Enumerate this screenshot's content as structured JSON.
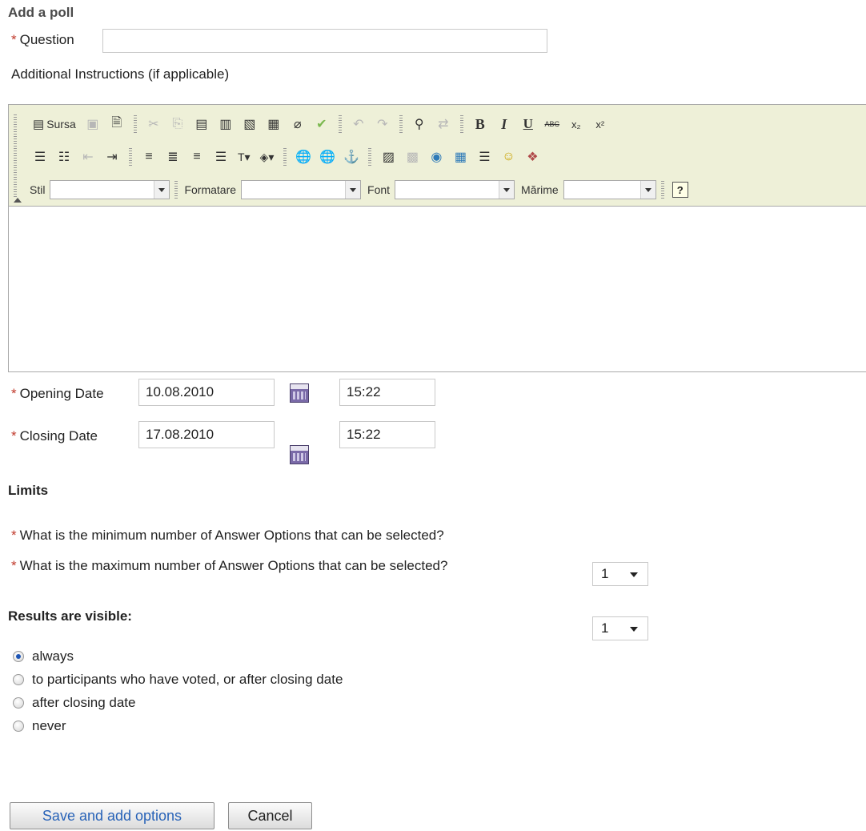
{
  "page": {
    "title": "Add a poll"
  },
  "form": {
    "required_marker": "*",
    "question_label": "Question",
    "question_value": "",
    "instructions_label": "Additional Instructions (if applicable)",
    "opening_label": "Opening Date",
    "opening_date": "10.08.2010",
    "opening_time": "15:22",
    "closing_label": "Closing Date",
    "closing_date": "17.08.2010",
    "closing_time": "15:22"
  },
  "editor": {
    "toolbar_row1": [
      {
        "name": "source-icon",
        "glyph": "▤"
      },
      {
        "name": "paste-icon",
        "glyph": "📋"
      },
      {
        "name": "templates-icon",
        "glyph": "🗎"
      },
      {
        "name": "cut-icon",
        "glyph": "✂"
      },
      {
        "name": "copy-icon",
        "glyph": "⎘"
      },
      {
        "name": "paste-text-icon",
        "glyph": "📋"
      },
      {
        "name": "paste-word-icon",
        "glyph": "📋"
      },
      {
        "name": "print-icon",
        "glyph": "🖶"
      },
      {
        "name": "select-all-icon",
        "glyph": "▦"
      },
      {
        "name": "remove-format-icon",
        "glyph": "⌫"
      },
      {
        "name": "spellcheck-icon",
        "glyph": "✓"
      },
      {
        "name": "undo-icon",
        "glyph": "↶"
      },
      {
        "name": "redo-icon",
        "glyph": "↷"
      },
      {
        "name": "find-icon",
        "glyph": "🔍"
      },
      {
        "name": "replace-icon",
        "glyph": "⇄"
      }
    ],
    "source_label": "Sursa",
    "bold_label": "B",
    "italic_label": "I",
    "underline_label": "U",
    "strike_label": "ABC",
    "style_label": "Stil",
    "format_label": "Formatare",
    "font_label": "Font",
    "size_label": "Mărime",
    "help_label": "?"
  },
  "limits": {
    "heading": "Limits",
    "min_question": "What is the minimum number of Answer Options that can be selected?",
    "min_value": "1",
    "max_question": "What is the maximum number of Answer Options that can be selected?",
    "max_value": "1"
  },
  "visibility": {
    "heading": "Results are visible:",
    "options": [
      {
        "label": "always",
        "checked": true
      },
      {
        "label": "to participants who have voted, or after closing date",
        "checked": false
      },
      {
        "label": "after closing date",
        "checked": false
      },
      {
        "label": "never",
        "checked": false
      }
    ]
  },
  "actions": {
    "save_label": "Save and add options",
    "cancel_label": "Cancel"
  },
  "colors": {
    "toolbar_bg": "#eef0d8",
    "required": "#c0392b",
    "primary_text": "#2a64b8"
  }
}
